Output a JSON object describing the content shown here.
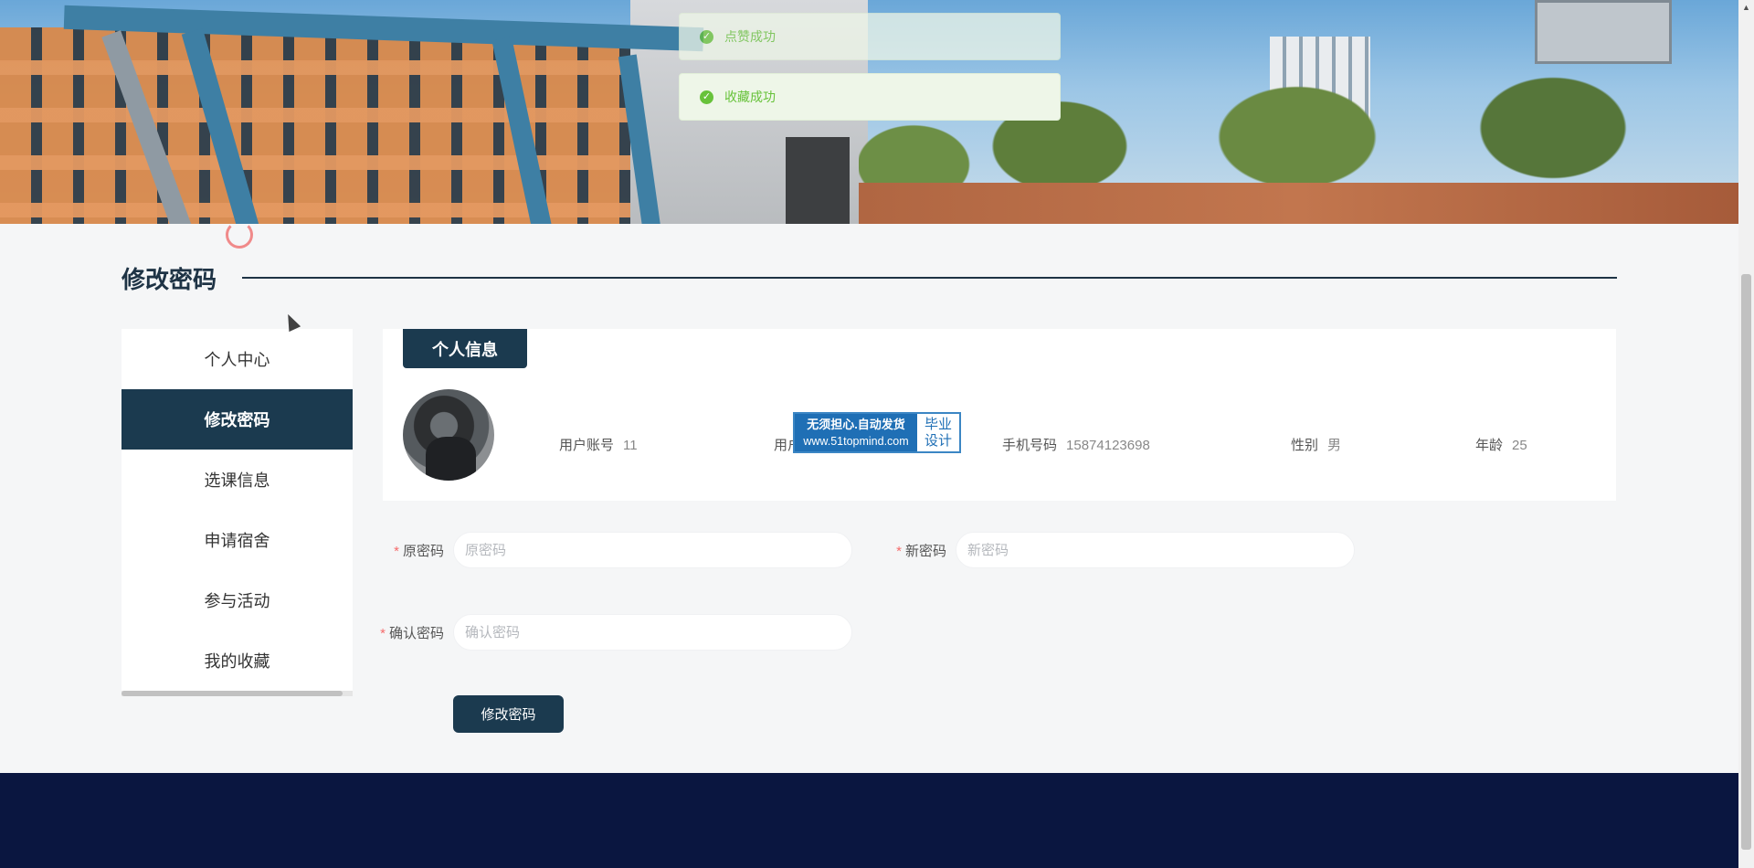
{
  "toasts": [
    {
      "text": "点赞成功"
    },
    {
      "text": "收藏成功"
    }
  ],
  "section": {
    "title": "修改密码"
  },
  "sidebar": {
    "items": [
      {
        "label": "个人中心",
        "active": false
      },
      {
        "label": "修改密码",
        "active": true
      },
      {
        "label": "选课信息",
        "active": false
      },
      {
        "label": "申请宿舍",
        "active": false
      },
      {
        "label": "参与活动",
        "active": false
      },
      {
        "label": "我的收藏",
        "active": false
      }
    ]
  },
  "profile": {
    "tab_label": "个人信息",
    "account_label": "用户账号",
    "account_value": "11",
    "name_label_partial": "用户",
    "phone_label": "手机号码",
    "phone_value": "15874123698",
    "gender_label": "性别",
    "gender_value": "男",
    "age_label": "年龄",
    "age_value": "25"
  },
  "watermark": {
    "line1": "无须担心.自动发货",
    "line2": "www.51topmind.com",
    "right1": "毕业",
    "right2": "设计"
  },
  "form": {
    "required_mark": "*",
    "old_password_label": "原密码",
    "old_password_placeholder": "原密码",
    "old_password_value": "",
    "new_password_label": "新密码",
    "new_password_placeholder": "新密码",
    "new_password_value": "",
    "confirm_password_label": "确认密码",
    "confirm_password_placeholder": "确认密码",
    "confirm_password_value": "",
    "submit_label": "修改密码"
  },
  "colors": {
    "primary": "#1b3a4f",
    "success": "#67c23a",
    "required": "#f56c6c",
    "footer": "#0a1640"
  },
  "icons": {
    "toast_icon": "check-circle-icon",
    "scroll_up": "triangle-up"
  }
}
